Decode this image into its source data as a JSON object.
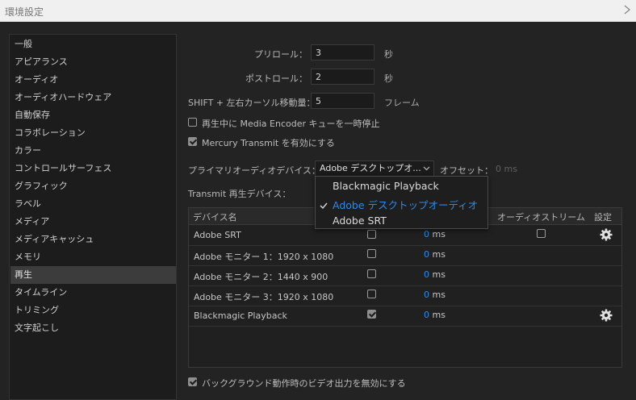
{
  "window": {
    "title": "環境設定"
  },
  "sidebar": {
    "items": [
      {
        "label": "一般"
      },
      {
        "label": "アピアランス"
      },
      {
        "label": "オーディオ"
      },
      {
        "label": "オーディオハードウェア"
      },
      {
        "label": "自動保存"
      },
      {
        "label": "コラボレーション"
      },
      {
        "label": "カラー"
      },
      {
        "label": "コントロールサーフェス"
      },
      {
        "label": "グラフィック"
      },
      {
        "label": "ラベル"
      },
      {
        "label": "メディア"
      },
      {
        "label": "メディアキャッシュ"
      },
      {
        "label": "メモリ"
      },
      {
        "label": "再生",
        "selected": true
      },
      {
        "label": "タイムライン"
      },
      {
        "label": "トリミング"
      },
      {
        "label": "文字起こし"
      }
    ]
  },
  "playback": {
    "preroll_label": "プリロール：",
    "preroll_value": "3",
    "preroll_unit": "秒",
    "postroll_label": "ポストロール：",
    "postroll_value": "2",
    "postroll_unit": "秒",
    "shift_label": "SHIFT + 左右カーソル移動量：",
    "shift_value": "5",
    "shift_unit": "フレーム",
    "pause_encoder_label": "再生中に Media  Encoder キューを一時停止",
    "pause_encoder_checked": false,
    "mercury_label": "Mercury  Transmit を有効にする",
    "mercury_checked": true,
    "primary_audio_label": "プライマリオーディオデバイス：",
    "primary_audio_value": "Adobe デスクトップオ...",
    "offset_label": "オフセット：",
    "offset_value": "0 ms",
    "transmit_label": "Transmit 再生デバイス：",
    "background_label": "バックグラウンド動作時のビデオ出力を無効にする",
    "background_checked": true
  },
  "dropdown": {
    "options": [
      {
        "label": "Blackmagic Playback",
        "selected": false
      },
      {
        "label": "Adobe デスクトップオーディオ",
        "selected": true
      },
      {
        "label": "Adobe SRT",
        "selected": false
      }
    ]
  },
  "devices": {
    "columns": {
      "name": "デバイス名",
      "audio_stream": "オーディオストリーム",
      "settings": "設定"
    },
    "ms_unit": "ms",
    "rows": [
      {
        "name": "Adobe SRT",
        "enabled": false,
        "offset": "0",
        "audio_stream": false,
        "has_settings": true
      },
      {
        "name": "Adobe モニター 1：1920 x 1080",
        "enabled": false,
        "offset": "0",
        "audio_stream": null,
        "has_settings": false
      },
      {
        "name": "Adobe モニター 2：1440 x 900",
        "enabled": false,
        "offset": "0",
        "audio_stream": null,
        "has_settings": false
      },
      {
        "name": "Adobe モニター 3：1920 x 1080",
        "enabled": false,
        "offset": "0",
        "audio_stream": null,
        "has_settings": false
      },
      {
        "name": "Blackmagic Playback",
        "enabled": true,
        "offset": "0",
        "audio_stream": null,
        "has_settings": true
      }
    ]
  },
  "colors": {
    "accent": "#2e8ae6",
    "panel": "#232323",
    "sidebar": "#1c1c1c",
    "selected_item": "#3c3c3c"
  },
  "icons": {
    "close": "chevron-right-icon",
    "settings": "gear-icon",
    "dropdown": "chevron-down-icon",
    "menu_check": "checkmark-icon"
  }
}
